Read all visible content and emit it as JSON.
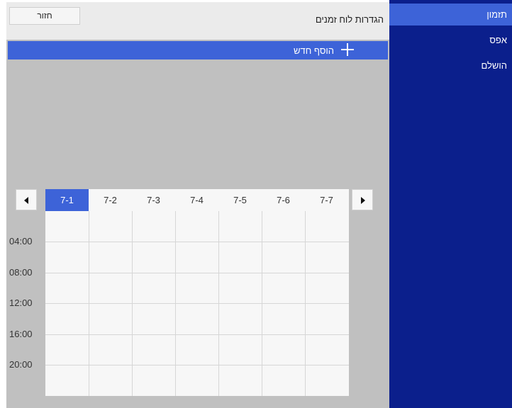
{
  "sidebar": {
    "items": [
      {
        "label": "תזמון"
      },
      {
        "label": "אפס"
      },
      {
        "label": "הושלם"
      }
    ]
  },
  "header": {
    "title": "הגדרות לוח זמנים",
    "back_label": "חזור"
  },
  "add_new": {
    "label": "הוסף חדש"
  },
  "calendar": {
    "days": [
      "7-1",
      "7-2",
      "7-3",
      "7-4",
      "7-5",
      "7-6",
      "7-7"
    ],
    "selected_day": "7-1",
    "times": [
      "04:00",
      "08:00",
      "12:00",
      "16:00",
      "20:00"
    ]
  },
  "colors": {
    "sidebar_bg": "#0b1f8c",
    "accent": "#3d63d8",
    "panel_gray": "#c0c0c0"
  }
}
